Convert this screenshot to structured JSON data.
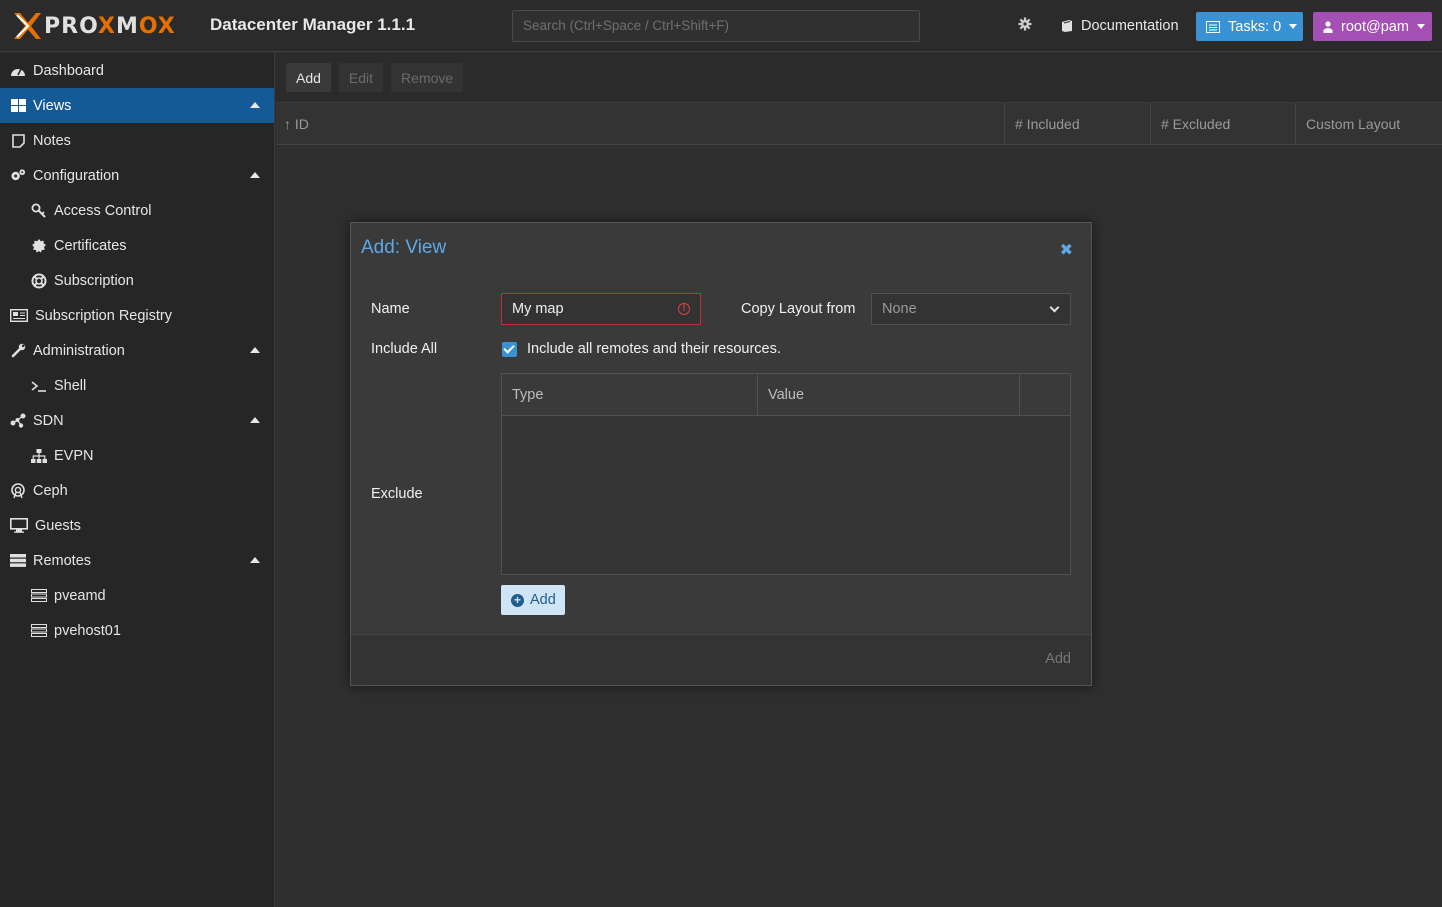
{
  "app": {
    "brand_pre": "PRO",
    "brand_x": "X",
    "brand_mid": "M",
    "brand_ox": "OX",
    "product": "Datacenter Manager 1.1.1"
  },
  "header": {
    "search_placeholder": "Search (Ctrl+Space / Ctrl+Shift+F)",
    "documentation": "Documentation",
    "tasks": "Tasks: 0",
    "user": "root@pam"
  },
  "sidebar": {
    "items": [
      {
        "label": "Dashboard",
        "icon": "dashboard-icon"
      },
      {
        "label": "Views",
        "icon": "views-icon",
        "active": true,
        "expanded": true
      },
      {
        "label": "Notes",
        "icon": "notes-icon"
      },
      {
        "label": "Configuration",
        "icon": "configuration-icon",
        "expanded": true
      },
      {
        "label": "Access Control",
        "icon": "key-icon",
        "sub": true
      },
      {
        "label": "Certificates",
        "icon": "certificate-icon",
        "sub": true
      },
      {
        "label": "Subscription",
        "icon": "lifebuoy-icon",
        "sub": true
      },
      {
        "label": "Subscription Registry",
        "icon": "registry-icon"
      },
      {
        "label": "Administration",
        "icon": "wrench-icon",
        "expanded": true
      },
      {
        "label": "Shell",
        "icon": "terminal-icon",
        "sub": true
      },
      {
        "label": "SDN",
        "icon": "sdn-icon",
        "expanded": true
      },
      {
        "label": "EVPN",
        "icon": "sitemap-icon",
        "sub": true
      },
      {
        "label": "Ceph",
        "icon": "ceph-icon"
      },
      {
        "label": "Guests",
        "icon": "desktop-icon"
      },
      {
        "label": "Remotes",
        "icon": "server-icon",
        "expanded": true
      },
      {
        "label": "pveamd",
        "icon": "server-icon",
        "sub": true
      },
      {
        "label": "pvehost01",
        "icon": "server-icon",
        "sub": true
      }
    ]
  },
  "toolbar": {
    "add": "Add",
    "edit": "Edit",
    "remove": "Remove"
  },
  "grid": {
    "columns": [
      "ID",
      "# Included",
      "# Excluded",
      "Custom Layout"
    ],
    "sort_arrow": "↑"
  },
  "dialog": {
    "title": "Add: View",
    "name_label": "Name",
    "name_value": "My map",
    "copy_label": "Copy Layout from",
    "copy_value": "None",
    "include_all_label": "Include All",
    "include_all_text": "Include all remotes and their resources.",
    "include_all_checked": true,
    "exclude_label": "Exclude",
    "exclude_columns": [
      "Type",
      "Value"
    ],
    "exclude_add": "Add",
    "submit": "Add"
  },
  "colors": {
    "accent": "#3892d3",
    "active_nav": "#135a96",
    "user_button": "#a44fb3",
    "brand_orange": "#e57000",
    "error": "#c03030"
  }
}
